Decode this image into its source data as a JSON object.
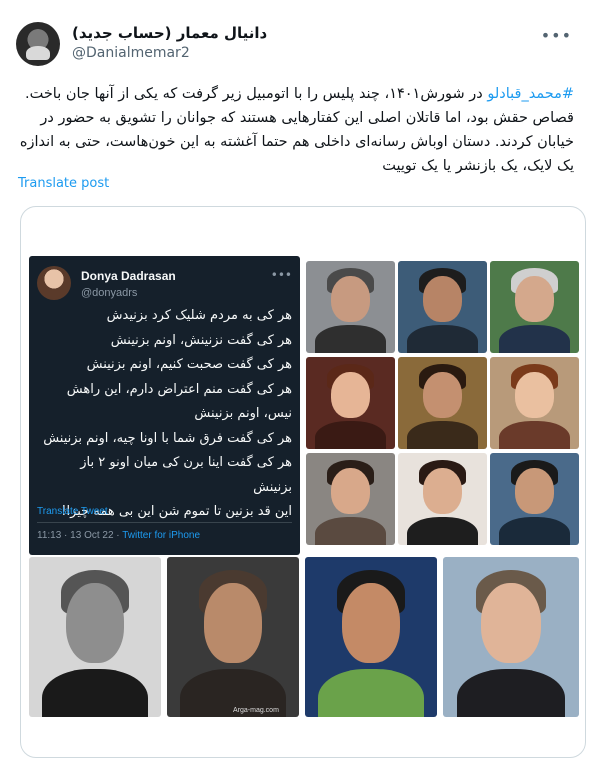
{
  "tweet": {
    "display_name": "دانیال معمار (حساب جدید)",
    "handle": "@Danialmemar2",
    "more_icon": "more-horizontal-icon",
    "hashtag": "#محمد_قبادلو",
    "text_rest": " در شورش۱۴۰۱، چند پلیس را با اتومبیل زیر گرفت که یکی از آنها جان باخت. قصاص حقش بود، اما قاتلان اصلی این کفتارهایی هستند که جوانان را تشویق به حضور در خیابان کردند. دستان اوباش رسانه‌ای داخلی هم حتما آغشته به این خون‌هاست، حتی به اندازه یک لایک، یک بازنشر یا یک توییت",
    "translate_label": "Translate post"
  },
  "quoted": {
    "name": "Donya Dadrasan",
    "handle": "@donyadrs",
    "lines": [
      "هر کی به مردم شلیک کرد بزنیدش",
      "هر کی گفت نزنینش، اونم بزنینش",
      "هر کی گفت صحبت کنیم، اونم بزنینش",
      "هر کی گفت منم اعتراض دارم، این راهش",
      "نیس، اونم بزنینش",
      "هر کی گفت فرق شما با اونا چیه، اونم بزنینش",
      "هر کی گفت اینا برن کی میان اونو ۲ باز",
      "بزنینش",
      "این قد بزنین تا تموم شن این بی همه چیزا!"
    ],
    "translate_label": "Translate Tweet",
    "time": "11:13 · 13 Oct 22 · ",
    "source": "Twitter for iPhone"
  },
  "watermark": "Arga-mag.com",
  "colors": {
    "link": "#1d9bf0",
    "dark_tweet_bg": "#15202b",
    "text": "#0f1419",
    "muted": "#536471"
  }
}
